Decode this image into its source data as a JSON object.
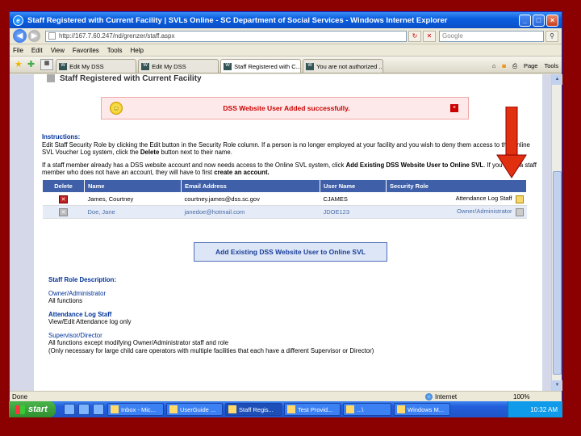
{
  "window": {
    "title": "Staff Registered with Current Facility | SVLs Online - SC Department of Social Services - Windows Internet Explorer",
    "url": "http://167.7.60.247/nd/grenzer/staff.aspx",
    "search_placeholder": "Google"
  },
  "menu": [
    "File",
    "Edit",
    "View",
    "Favorites",
    "Tools",
    "Help"
  ],
  "tabs": [
    {
      "label": "Edit My DSS",
      "active": false
    },
    {
      "label": "Edit My DSS",
      "active": false
    },
    {
      "label": "Staff Registered with C...",
      "active": true
    },
    {
      "label": "You are not authorized ...",
      "active": false
    }
  ],
  "tab_tools": {
    "page": "Page",
    "tools": "Tools"
  },
  "page": {
    "title": "Staff Registered with Current Facility",
    "message": "DSS Website User Added successfully.",
    "instructions_heading": "Instructions:",
    "instructions_1a": "Edit Staff Security Role by clicking the Edit button in the Security Role column. If a person is no longer employed at your facility and you wish to deny them access to the Online SVL Voucher Log system, click the ",
    "instructions_1b": "Delete",
    "instructions_1c": " button next to their name.",
    "instructions_2a": "If a staff member already has a DSS website account and now needs access to the Online SVL system, click ",
    "instructions_2b": "Add Existing DSS Website User to Online SVL",
    "instructions_2c": ". If you have a staff member who does not have an account, they will have to first ",
    "instructions_2d": "create an account."
  },
  "table": {
    "headers": [
      "Delete",
      "Name",
      "Email Address",
      "User Name",
      "Security Role"
    ],
    "rows": [
      {
        "name": "James, Courtney",
        "email": "courtney.james@dss.sc.gov",
        "user": "CJAMES",
        "role": "Attendance Log Staff"
      },
      {
        "name": "Doe, Jane",
        "email": "janedoe@hotmail.com",
        "user": "JDOE123",
        "role": "Owner/Administrator"
      }
    ]
  },
  "add_button": "Add Existing DSS Website User to Online SVL",
  "roles": {
    "heading": "Staff Role Description:",
    "r1_title": "Owner/Administrator",
    "r1_desc": "All functions",
    "r2_title": "Attendance Log Staff",
    "r2_desc": "View/Edit Attendance log only",
    "r3_title": "Supervisor/Director",
    "r3_desc": "All functions except modifying Owner/Administrator staff and role",
    "r3_note": "(Only necessary for large child care operators with multiple facilities that each have a different Supervisor or Director)"
  },
  "status": {
    "left": "Done",
    "zone": "Internet",
    "zoom": "100%"
  },
  "taskbar": {
    "start": "start",
    "items": [
      "Inbox - Mic...",
      "UserGuide ...",
      "Staff Regis...",
      "Test Provid...",
      "...\\",
      "Windows M..."
    ],
    "active_index": 2,
    "clock": "10:32 AM"
  },
  "colors": {
    "accent": "#3f5fa8",
    "arrow": "#e03010",
    "background": "#8b0000"
  }
}
